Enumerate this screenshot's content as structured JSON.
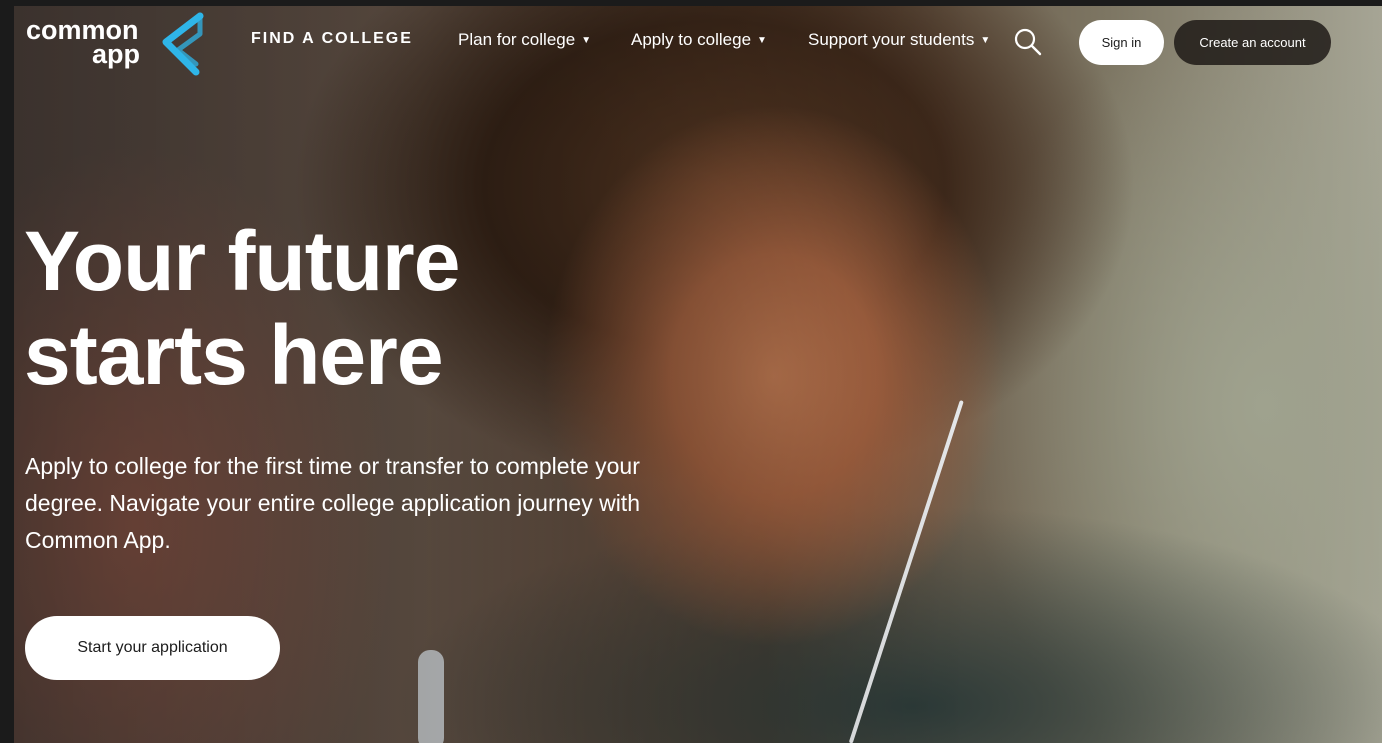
{
  "header": {
    "logo": {
      "line1": "common",
      "line2": "app",
      "mark_color": "#2fb5e8"
    },
    "nav": {
      "find_college": "FIND A COLLEGE",
      "plan": "Plan for college",
      "apply": "Apply to college",
      "support": "Support your students",
      "caret": "▼"
    },
    "search_icon": "search-icon",
    "sign_in": "Sign in",
    "create_account": "Create an account"
  },
  "hero": {
    "headline_line1": "Your future",
    "headline_line2": "starts here",
    "description": "Apply to college for the first time or transfer to complete your degree. Navigate your entire college application journey with Common App.",
    "cta": "Start your application"
  },
  "colors": {
    "accent": "#2fb5e8",
    "text_light": "#ffffff",
    "text_dark": "#1c1c1c"
  }
}
